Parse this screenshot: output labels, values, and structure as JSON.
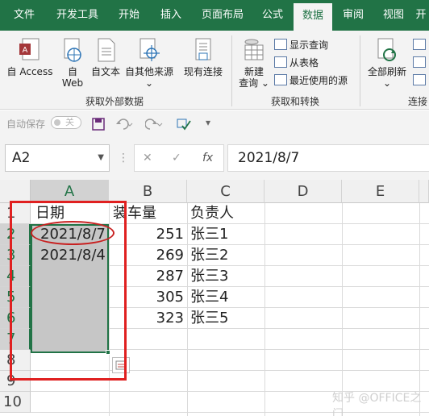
{
  "tabs": [
    "文件",
    "开发工具",
    "开始",
    "插入",
    "页面布局",
    "公式",
    "数据",
    "审阅",
    "视图",
    "开"
  ],
  "active_tab": "数据",
  "ribbon": {
    "get_external": {
      "access": "自 Access",
      "web_line1": "自",
      "web_line2": "Web",
      "text": "自文本",
      "other_line1": "自其他来源",
      "other_line2": "⌄",
      "existing": "现有连接",
      "group_label": "获取外部数据"
    },
    "transform": {
      "new_query_line1": "新建",
      "new_query_line2": "查询 ⌄",
      "show_queries": "显示查询",
      "from_table": "从表格",
      "recent_sources": "最近使用的源",
      "group_label": "获取和转换"
    },
    "connections": {
      "refresh_all_line1": "全部刷新",
      "refresh_all_line2": "⌄",
      "group_label": "连接"
    }
  },
  "qat": {
    "autosave": "自动保存",
    "toggle": "关"
  },
  "formula_bar": {
    "name_box": "A2",
    "formula": "2021/8/7",
    "cancel": "✕",
    "confirm": "✓",
    "fx": "fx"
  },
  "sheet": {
    "columns": [
      "A",
      "B",
      "C",
      "D",
      "E"
    ],
    "rows": [
      "1",
      "2",
      "3",
      "4",
      "5",
      "6",
      "7",
      "8",
      "9",
      "10"
    ],
    "header_row": {
      "a": "日期",
      "b": "装车量",
      "c": "负责人"
    },
    "data": [
      {
        "a": "2021/8/7",
        "b": "251",
        "c": "张三1"
      },
      {
        "a": "2021/8/4",
        "b": "269",
        "c": "张三2"
      },
      {
        "a": "",
        "b": "287",
        "c": "张三3"
      },
      {
        "a": "",
        "b": "305",
        "c": "张三4"
      },
      {
        "a": "",
        "b": "323",
        "c": "张三5"
      }
    ]
  },
  "watermark": "知乎 @OFFICE之门"
}
